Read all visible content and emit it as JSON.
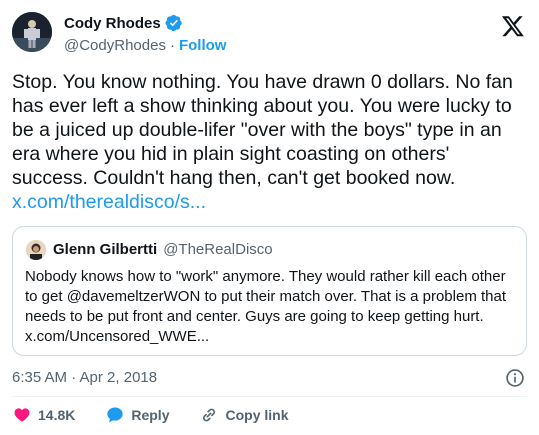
{
  "author": {
    "name": "Cody Rhodes",
    "handle": "@CodyRhodes",
    "separator": "·",
    "follow_label": "Follow"
  },
  "tweet": {
    "text": "Stop. You know nothing. You have drawn 0 dollars. No fan has ever left a show thinking about you. You were lucky to be a juiced up double-lifer \"over with the boys\" type in an era where you hid in plain sight coasting on others' success. Couldn't hang then, can't get booked now.",
    "link": "x.com/therealdisco/s..."
  },
  "quote": {
    "name": "Glenn Gilbertti",
    "handle": "@TheRealDisco",
    "text": "Nobody knows how to \"work\" anymore.  They would rather kill each other to get @davemeltzerWON to put their match over.  That is a problem that needs to be put front and center.  Guys are going to keep getting hurt.",
    "link": "x.com/Uncensored_WWE..."
  },
  "timestamp": "6:35 AM · Apr 2, 2018",
  "actions": {
    "like_count": "14.8K",
    "reply_label": "Reply",
    "copy_label": "Copy link"
  },
  "colors": {
    "accent": "#1d9bf0",
    "like": "#f91880",
    "text": "#0f1419",
    "muted": "#536471"
  },
  "icons": [
    "verified-badge-icon",
    "x-logo-icon",
    "info-icon",
    "heart-icon",
    "reply-icon",
    "link-icon"
  ]
}
